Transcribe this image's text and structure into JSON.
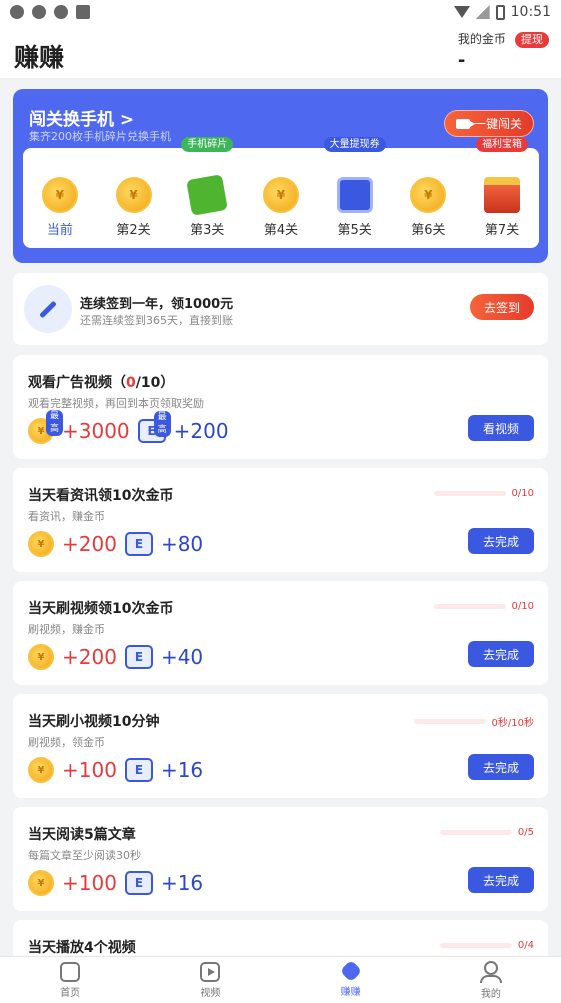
{
  "status_bar": {
    "time": "10:51"
  },
  "header": {
    "title": "赚赚",
    "coin_label": "我的金币",
    "withdraw": "提现",
    "coin_value": "-"
  },
  "challenge": {
    "title": "闯关换手机 >",
    "subtitle": "集齐200枚手机碎片兑换手机",
    "button": "一键闯关",
    "levels": [
      {
        "label": "当前",
        "icon": "gold-coin-icon",
        "tag": ""
      },
      {
        "label": "第2关",
        "icon": "gold-coin-icon",
        "tag": ""
      },
      {
        "label": "第3关",
        "icon": "puzzle-icon",
        "tag": "手机碎片"
      },
      {
        "label": "第4关",
        "icon": "gold-coin-icon",
        "tag": ""
      },
      {
        "label": "第5关",
        "icon": "ticket-icon",
        "tag": "大量提现券"
      },
      {
        "label": "第6关",
        "icon": "gold-coin-icon",
        "tag": ""
      },
      {
        "label": "第7关",
        "icon": "treasure-chest-icon",
        "tag": "福利宝箱"
      }
    ]
  },
  "checkin": {
    "title": "连续签到一年，领1000元",
    "subtitle": "还需连续签到365天，直接到账",
    "button": "去签到"
  },
  "tasks": [
    {
      "title_prefix": "观看广告视频（",
      "title_highlight": "0",
      "title_suffix": "/10）",
      "subtitle": "观看完整视频，再回到本页领取奖励",
      "coins": "+3000",
      "tickets": "+200",
      "coin_badge": "最高",
      "ticket_badge": "最高",
      "button": "看视频"
    },
    {
      "title": "当天看资讯领10次金币",
      "subtitle": "看资讯，赚金币",
      "coins": "+200",
      "tickets": "+80",
      "progress": "0/10",
      "button": "去完成"
    },
    {
      "title": "当天刷视频领10次金币",
      "subtitle": "刷视频，赚金币",
      "coins": "+200",
      "tickets": "+40",
      "progress": "0/10",
      "button": "去完成"
    },
    {
      "title": "当天刷小视频10分钟",
      "subtitle": "刷视频，领金币",
      "coins": "+100",
      "tickets": "+16",
      "progress": "0秒/10秒",
      "button": "去完成"
    },
    {
      "title": "当天阅读5篇文章",
      "subtitle": "每篇文章至少阅读30秒",
      "coins": "+100",
      "tickets": "+16",
      "progress": "0/5",
      "button": "去完成"
    },
    {
      "title": "当天播放4个视频",
      "progress": "0/4"
    }
  ],
  "tabbar": {
    "home": "首页",
    "video": "视频",
    "earn": "赚赚",
    "me": "我的"
  },
  "colors": {
    "brand_blue": "#4f68f0",
    "accent_red": "#e83a3a",
    "coin_gold": "#f1a514"
  }
}
